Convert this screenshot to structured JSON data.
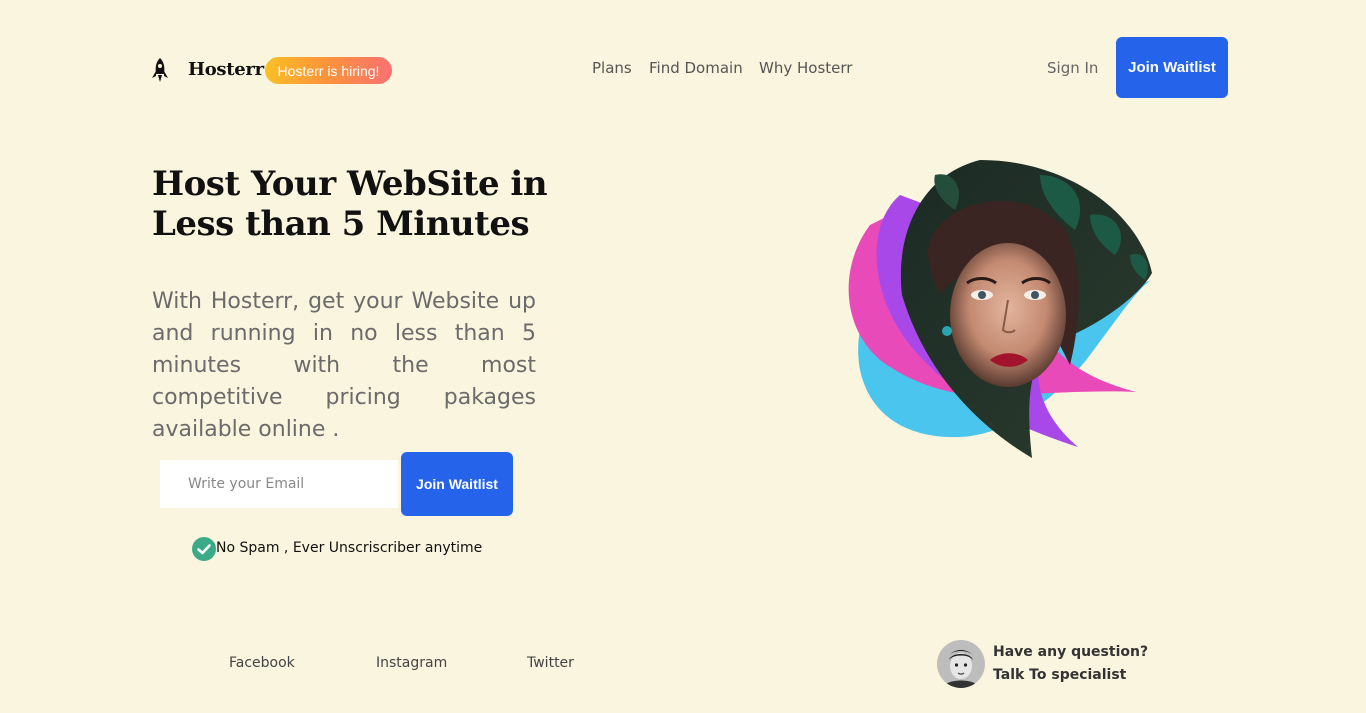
{
  "header": {
    "brand": "Hosterr",
    "hiring_badge": "Hosterr is hiring!",
    "nav": [
      "Plans",
      "Find Domain",
      "Why Hosterr"
    ],
    "sign_in": "Sign In",
    "cta": "Join Waitlist"
  },
  "hero": {
    "title": "Host Your WebSite in Less than 5 Minutes",
    "text": "With Hosterr, get your Website up and running in no less than 5 minutes with the most competitive pricing pakages available online .",
    "email_placeholder": "Write your Email",
    "cta": "Join Waitlist",
    "note": "No Spam , Ever Unscriscriber anytime"
  },
  "footer": {
    "social": [
      "Facebook",
      "Instagram",
      "Twitter"
    ],
    "question": "Have any question?",
    "specialist": "Talk To specialist"
  },
  "colors": {
    "background": "#faf5de",
    "primary": "#2563eb",
    "check": "#3bab87"
  }
}
